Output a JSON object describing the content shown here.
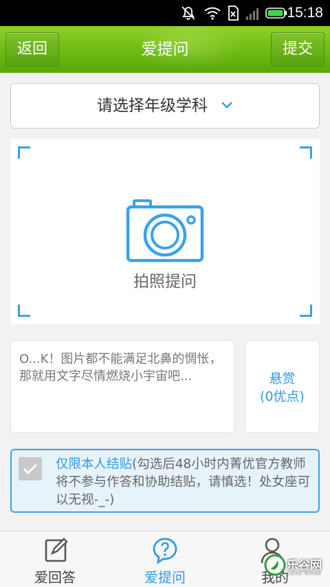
{
  "status_bar": {
    "time": "15:18"
  },
  "header": {
    "back_label": "返回",
    "title": "爱提问",
    "submit_label": "提交"
  },
  "subject_selector": {
    "label": "请选择年级学科"
  },
  "photo_area": {
    "label": "拍照提问"
  },
  "question_input": {
    "placeholder": "O...K！图片都不能满足北鼻的惆怅，那就用文字尽情燃烧小宇宙吧..."
  },
  "reward": {
    "line1": "悬赏",
    "line2": "(0优点)"
  },
  "restriction": {
    "highlight": "仅限本人结贴",
    "note": "(勾选后48小时内菁优官方教师将不参与作答和协助结贴，请慎选！处女座可以无视-_-)",
    "checked": false
  },
  "bottom_nav": {
    "tabs": [
      {
        "label": "爱回答",
        "icon": "edit-icon",
        "active": false
      },
      {
        "label": "爱提问",
        "icon": "question-bubble-icon",
        "active": true
      },
      {
        "label": "我的",
        "icon": "user-icon",
        "active": false
      }
    ]
  },
  "watermark": {
    "text": "乐谷网",
    "sub": "LEKU GAME"
  },
  "colors": {
    "header_green": "#6cba12",
    "accent_blue": "#2e9be5"
  }
}
